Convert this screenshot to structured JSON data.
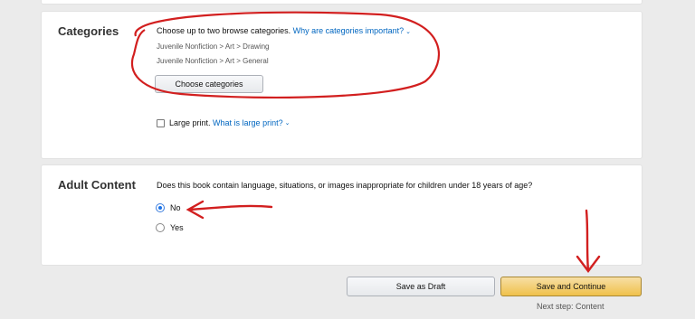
{
  "categories": {
    "title": "Categories",
    "prompt": "Choose up to two browse categories.",
    "help_link": "Why are categories important?",
    "selected": [
      "Juvenile Nonfiction > Art > Drawing",
      "Juvenile Nonfiction > Art > General"
    ],
    "choose_button": "Choose categories",
    "large_print_label": "Large print.",
    "large_print_link": "What is large print?",
    "large_print_checked": false
  },
  "adult_content": {
    "title": "Adult Content",
    "question": "Does this book contain language, situations, or images inappropriate for children under 18 years of age?",
    "options": [
      {
        "label": "No",
        "selected": true
      },
      {
        "label": "Yes",
        "selected": false
      }
    ]
  },
  "actions": {
    "save_draft": "Save as Draft",
    "save_continue": "Save and Continue",
    "next_step": "Next step: Content"
  },
  "colors": {
    "annotation_red": "#d21f1f",
    "link": "#0066c0",
    "primary_button": "#f0c14b"
  }
}
